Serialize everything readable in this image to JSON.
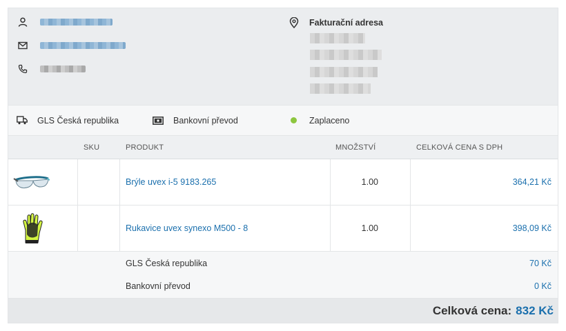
{
  "customer": {
    "billing_title": "Fakturační adresa"
  },
  "shipping": {
    "carrier": "GLS Česká republika",
    "payment": "Bankovní převod",
    "status": "Zaplaceno"
  },
  "table": {
    "headers": [
      "SKU",
      "PRODUKT",
      "MNOŽSTVÍ",
      "CELKOVÁ CENA S DPH"
    ],
    "rows": [
      {
        "sku": "",
        "product": "Brýle uvex i-5 9183.265",
        "qty": "1.00",
        "price": "364,21 Kč",
        "image": "safety-glasses-image"
      },
      {
        "sku": "",
        "product": "Rukavice uvex synexo M500 - 8",
        "qty": "1.00",
        "price": "398,09 Kč",
        "image": "work-gloves-image"
      }
    ],
    "extras": [
      {
        "label": "GLS Česká republika",
        "price": "70 Kč"
      },
      {
        "label": "Bankovní převod",
        "price": "0 Kč"
      }
    ]
  },
  "total": {
    "label": "Celková cena:",
    "amount": "832 Kč"
  },
  "colors": {
    "accent": "#1a6fad",
    "paid": "#8dc63f"
  }
}
